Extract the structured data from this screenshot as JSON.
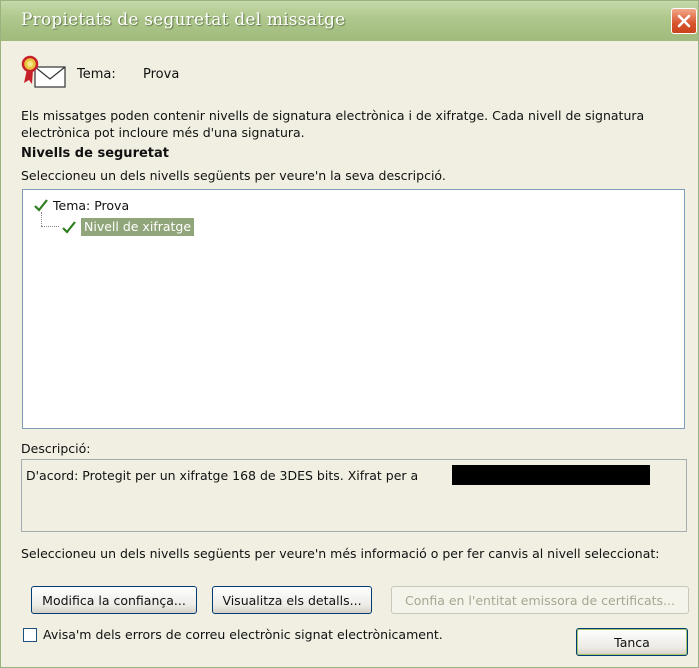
{
  "window": {
    "title": "Propietats de seguretat del missatge"
  },
  "subject": {
    "label": "Tema:",
    "value": "Prova"
  },
  "intro_text": "Els missatges poden contenir nivells de signatura electrònica i de xifratge. Cada nivell de signatura electrònica pot incloure més d'una signatura.",
  "security_levels": {
    "title": "Nivells de seguretat",
    "instruction": "Seleccioneu un dels nivells següents per veure'n la seva descripció.",
    "tree": [
      {
        "label": "Tema: Prova",
        "icon": "check-icon",
        "selected": false
      },
      {
        "label": "Nivell de xifratge",
        "icon": "check-icon",
        "selected": true
      }
    ]
  },
  "description": {
    "label": "Descripció:",
    "text": "D'acord: Protegit per un xifratge 168 de 3DES bits. Xifrat per a"
  },
  "info_text": "Seleccioneu un dels nivells següents per veure'n més informació o per fer canvis al nivell seleccionat:",
  "buttons": {
    "modify_trust": "Modifica la confiança...",
    "view_details": "Visualitza els detalls...",
    "trust_ca": "Confia en l'entitat emissora de certificats...",
    "close": "Tanca"
  },
  "notify_checkbox": {
    "label": "Avisa'm dels errors de correu electrònic signat electrònicament.",
    "checked": false
  },
  "colors": {
    "titlebar": "#aec78c",
    "selection": "#91a57b",
    "check": "#2e7d1f",
    "close_button": "#d8542c"
  }
}
